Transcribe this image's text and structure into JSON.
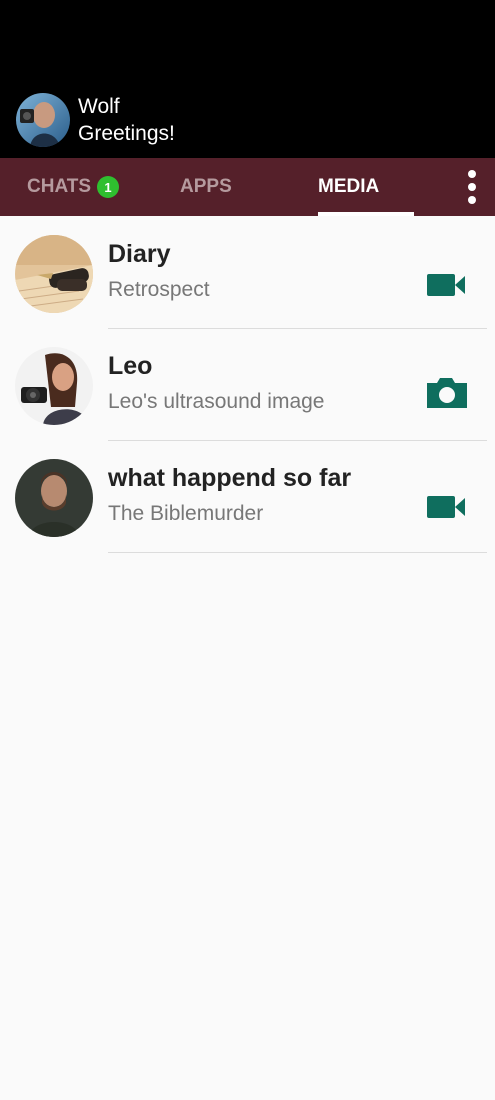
{
  "profile": {
    "name": "Wolf",
    "status": "Greetings!",
    "avatar_icon": "user-avatar-photo"
  },
  "tabs": [
    {
      "label": "CHATS",
      "badge": "1",
      "active": false
    },
    {
      "label": "APPS",
      "active": false
    },
    {
      "label": "MEDIA",
      "active": true
    }
  ],
  "menu_icon": "more-vert-icon",
  "media_items": [
    {
      "title": "Diary",
      "subtitle": "Retrospect",
      "type_icon": "video-camera-icon",
      "thumb": "fountain-pen-photo"
    },
    {
      "title": "Leo",
      "subtitle": "Leo's ultrasound image",
      "type_icon": "photo-camera-icon",
      "thumb": "woman-with-camera-photo"
    },
    {
      "title": "what happend so far",
      "subtitle": "The Biblemurder",
      "type_icon": "video-camera-icon",
      "thumb": "bearded-man-photo"
    }
  ],
  "colors": {
    "header_bg": "#000000",
    "tabbar_bg": "#55202a",
    "tab_inactive": "#b59a9e",
    "badge": "#2fbf2f",
    "icon_teal": "#0f6e5e",
    "title_text": "#222222",
    "subtitle_text": "#777777"
  }
}
